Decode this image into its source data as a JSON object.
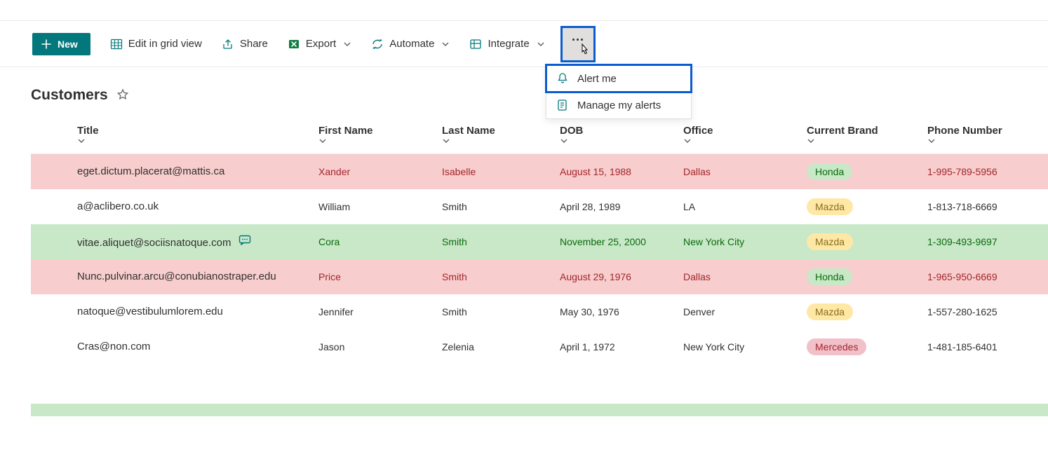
{
  "toolbar": {
    "new_label": "New",
    "edit_grid_label": "Edit in grid view",
    "share_label": "Share",
    "export_label": "Export",
    "automate_label": "Automate",
    "integrate_label": "Integrate"
  },
  "dropdown": {
    "alert_me": "Alert me",
    "manage_alerts": "Manage my alerts"
  },
  "page": {
    "title": "Customers"
  },
  "columns": {
    "title": "Title",
    "first_name": "First Name",
    "last_name": "Last Name",
    "dob": "DOB",
    "office": "Office",
    "current_brand": "Current Brand",
    "phone": "Phone Number"
  },
  "rows": [
    {
      "row_class": "row-pink",
      "title": "eget.dictum.placerat@mattis.ca",
      "first_name": "Xander",
      "last_name": "Isabelle",
      "dob": "August 15, 1988",
      "office": "Dallas",
      "brand": "Honda",
      "brand_class": "pill-honda",
      "phone": "1-995-789-5956",
      "has_chat": false
    },
    {
      "row_class": "",
      "title": "a@aclibero.co.uk",
      "first_name": "William",
      "last_name": "Smith",
      "dob": "April 28, 1989",
      "office": "LA",
      "brand": "Mazda",
      "brand_class": "pill-mazda",
      "phone": "1-813-718-6669",
      "has_chat": false
    },
    {
      "row_class": "row-green",
      "title": "vitae.aliquet@sociisnatoque.com",
      "first_name": "Cora",
      "last_name": "Smith",
      "dob": "November 25, 2000",
      "office": "New York City",
      "brand": "Mazda",
      "brand_class": "pill-mazda",
      "phone": "1-309-493-9697",
      "has_chat": true
    },
    {
      "row_class": "row-pink",
      "title": "Nunc.pulvinar.arcu@conubianostraper.edu",
      "first_name": "Price",
      "last_name": "Smith",
      "dob": "August 29, 1976",
      "office": "Dallas",
      "brand": "Honda",
      "brand_class": "pill-honda",
      "phone": "1-965-950-6669",
      "has_chat": false
    },
    {
      "row_class": "",
      "title": "natoque@vestibulumlorem.edu",
      "first_name": "Jennifer",
      "last_name": "Smith",
      "dob": "May 30, 1976",
      "office": "Denver",
      "brand": "Mazda",
      "brand_class": "pill-mazda",
      "phone": "1-557-280-1625",
      "has_chat": false
    },
    {
      "row_class": "",
      "title": "Cras@non.com",
      "first_name": "Jason",
      "last_name": "Zelenia",
      "dob": "April 1, 1972",
      "office": "New York City",
      "brand": "Mercedes",
      "brand_class": "pill-mercedes",
      "phone": "1-481-185-6401",
      "has_chat": false
    }
  ]
}
